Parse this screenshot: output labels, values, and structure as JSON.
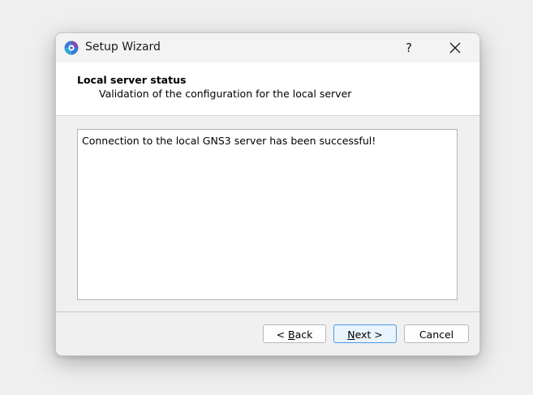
{
  "window": {
    "title": "Setup Wizard",
    "help_label": "?",
    "app_icon": "gns3-app-icon",
    "close_icon": "close-icon"
  },
  "header": {
    "title": "Local server status",
    "subtitle": "Validation of the configuration for the local server"
  },
  "content": {
    "message": "Connection to the local GNS3 server has been successful!"
  },
  "buttons": {
    "back_prefix": "< ",
    "back_mnemonic": "B",
    "back_rest": "ack",
    "next_mnemonic": "N",
    "next_rest": "ext >",
    "cancel_label": "Cancel"
  },
  "colors": {
    "accent": "#4a9be0",
    "icon_blue": "#3b7bd4",
    "icon_purple": "#7a4fb5"
  }
}
